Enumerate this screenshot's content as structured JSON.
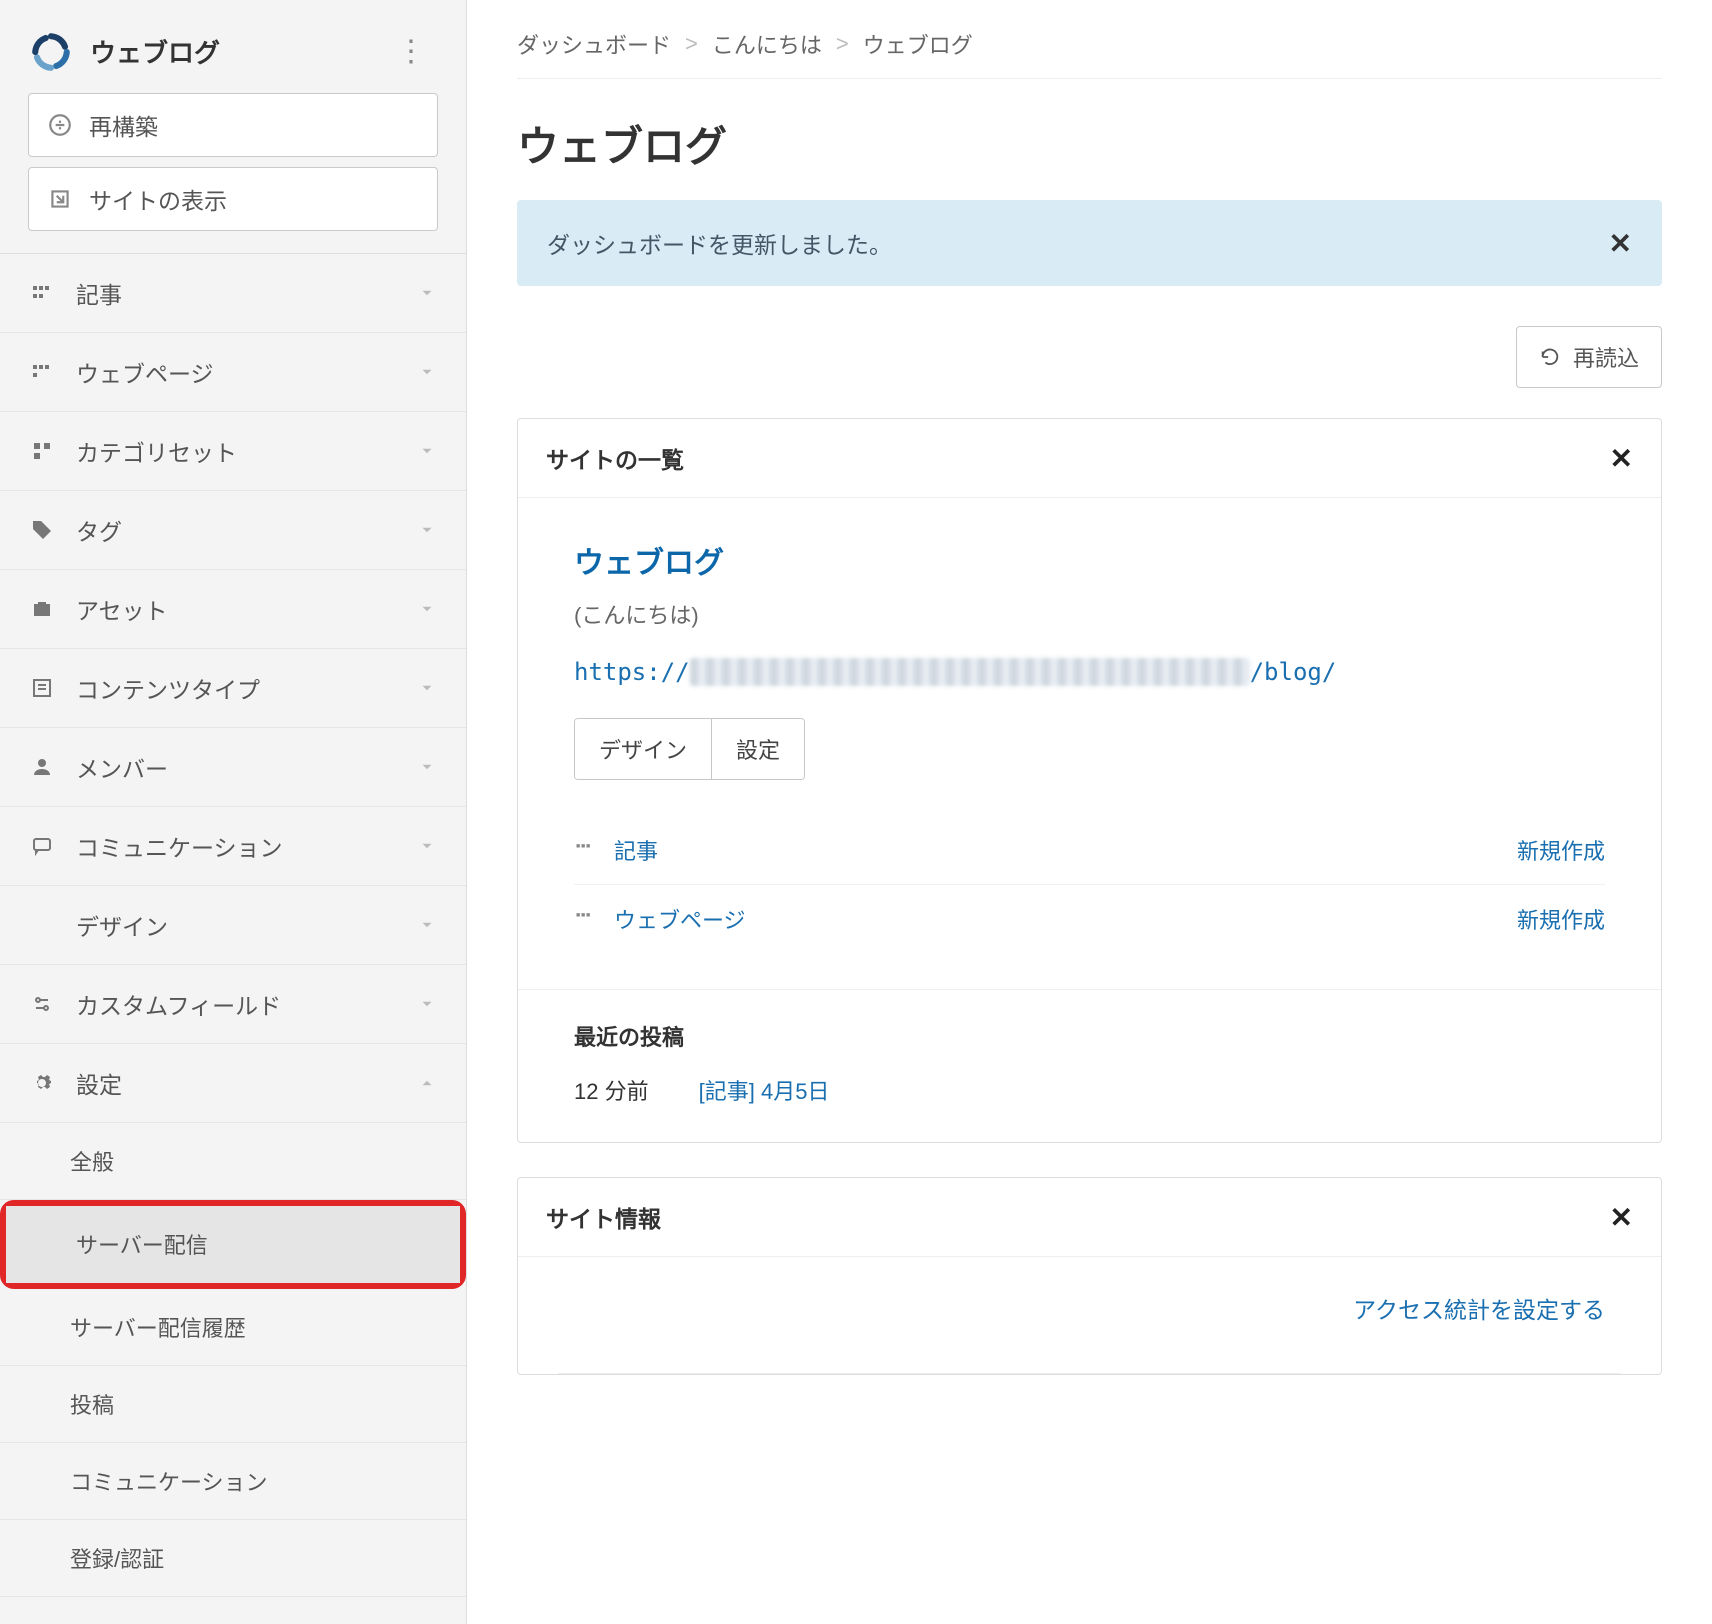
{
  "sidebar": {
    "brand": "ウェブログ",
    "actions": {
      "rebuild": "再構築",
      "view_site": "サイトの表示"
    },
    "nav": [
      {
        "label": "記事"
      },
      {
        "label": "ウェブページ"
      },
      {
        "label": "カテゴリセット"
      },
      {
        "label": "タグ"
      },
      {
        "label": "アセット"
      },
      {
        "label": "コンテンツタイプ"
      },
      {
        "label": "メンバー"
      },
      {
        "label": "コミュニケーション"
      },
      {
        "label": "デザイン"
      },
      {
        "label": "カスタムフィールド"
      },
      {
        "label": "設定",
        "expanded": true
      }
    ],
    "settings_sub": [
      {
        "label": "全般"
      },
      {
        "label": "サーバー配信",
        "highlighted": true
      },
      {
        "label": "サーバー配信履歴"
      },
      {
        "label": "投稿"
      },
      {
        "label": "コミュニケーション"
      },
      {
        "label": "登録/認証"
      }
    ]
  },
  "breadcrumb": {
    "a": "ダッシュボード",
    "b": "こんにちは",
    "c": "ウェブログ"
  },
  "page_title": "ウェブログ",
  "alert": {
    "text": "ダッシュボードを更新しました。"
  },
  "reload_label": "再読込",
  "site_list": {
    "card_title": "サイトの一覧",
    "site_name": "ウェブログ",
    "site_sub": "(こんにちは)",
    "url_prefix": "https://",
    "url_suffix": "/blog/",
    "btn_design": "デザイン",
    "btn_settings": "設定",
    "rows": [
      {
        "label": "記事",
        "action": "新規作成"
      },
      {
        "label": "ウェブページ",
        "action": "新規作成"
      }
    ],
    "recent_title": "最近の投稿",
    "recent_time": "12 分前",
    "recent_type": "[記事]",
    "recent_link": "4月5日"
  },
  "site_info": {
    "card_title": "サイト情報",
    "link": "アクセス統計を設定する"
  }
}
